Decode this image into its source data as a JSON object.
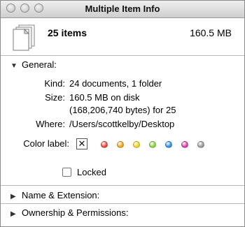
{
  "window": {
    "title": "Multiple Item Info"
  },
  "summary": {
    "count": "25 items",
    "size": "160.5 MB"
  },
  "sections": {
    "general": "General:",
    "name_extension": "Name & Extension:",
    "ownership": "Ownership & Permissions:"
  },
  "general": {
    "kind_label": "Kind:",
    "kind_value": "24 documents, 1 folder",
    "size_label": "Size:",
    "size_value_line1": "160.5 MB on disk",
    "size_value_line2": "(168,206,740 bytes) for 25",
    "where_label": "Where:",
    "where_value": "/Users/scottkelby/Desktop",
    "color_label": "Color label:",
    "color_none_symbol": "✕",
    "label_colors": [
      "#e8473f",
      "#f2a31c",
      "#f2d31b",
      "#8dd33c",
      "#2f8ee6",
      "#d63fa5",
      "#9a9a9a"
    ],
    "locked_label": "Locked"
  },
  "icons": {
    "doc_stack": "documents-stack-icon",
    "disclosure_open": "triangle-down-icon",
    "disclosure_closed": "triangle-right-icon"
  }
}
